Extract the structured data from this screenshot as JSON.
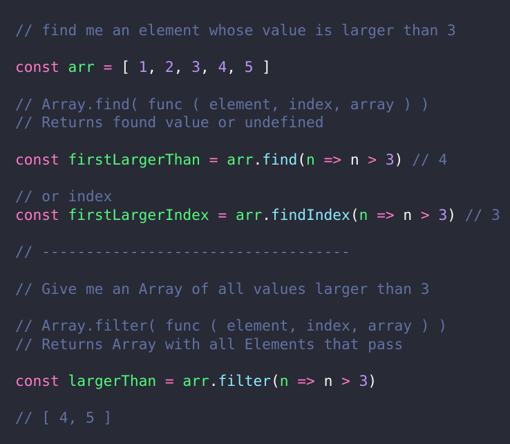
{
  "editor": {
    "theme_colors": {
      "background": "#282a36",
      "comment": "#6272a4",
      "keyword": "#ff79c6",
      "variable": "#50fa7b",
      "number": "#bd93f9",
      "method": "#8be9fd",
      "plain": "#f8f8f2"
    },
    "lines": [
      [
        {
          "t": "comment",
          "v": "// find me an element whose value is larger than 3"
        }
      ],
      [],
      [
        {
          "t": "keyword",
          "v": "const"
        },
        {
          "t": "plain",
          "v": " "
        },
        {
          "t": "variable",
          "v": "arr"
        },
        {
          "t": "plain",
          "v": " "
        },
        {
          "t": "operator",
          "v": "="
        },
        {
          "t": "plain",
          "v": " "
        },
        {
          "t": "punct",
          "v": "[ "
        },
        {
          "t": "number",
          "v": "1"
        },
        {
          "t": "punct",
          "v": ", "
        },
        {
          "t": "number",
          "v": "2"
        },
        {
          "t": "punct",
          "v": ", "
        },
        {
          "t": "number",
          "v": "3"
        },
        {
          "t": "punct",
          "v": ", "
        },
        {
          "t": "number",
          "v": "4"
        },
        {
          "t": "punct",
          "v": ", "
        },
        {
          "t": "number",
          "v": "5"
        },
        {
          "t": "punct",
          "v": " ]"
        }
      ],
      [],
      [
        {
          "t": "comment",
          "v": "// Array.find( func ( element, index, array ) )"
        }
      ],
      [
        {
          "t": "comment",
          "v": "// Returns found value or undefined"
        }
      ],
      [],
      [
        {
          "t": "keyword",
          "v": "const"
        },
        {
          "t": "plain",
          "v": " "
        },
        {
          "t": "variable",
          "v": "firstLargerThan"
        },
        {
          "t": "plain",
          "v": " "
        },
        {
          "t": "operator",
          "v": "="
        },
        {
          "t": "plain",
          "v": " "
        },
        {
          "t": "variable",
          "v": "arr"
        },
        {
          "t": "punct",
          "v": "."
        },
        {
          "t": "method",
          "v": "find"
        },
        {
          "t": "punct",
          "v": "("
        },
        {
          "t": "param",
          "v": "n"
        },
        {
          "t": "plain",
          "v": " "
        },
        {
          "t": "operator",
          "v": "=>"
        },
        {
          "t": "plain",
          "v": " n "
        },
        {
          "t": "operator",
          "v": ">"
        },
        {
          "t": "plain",
          "v": " "
        },
        {
          "t": "number",
          "v": "3"
        },
        {
          "t": "punct",
          "v": ")"
        },
        {
          "t": "plain",
          "v": " "
        },
        {
          "t": "comment",
          "v": "// 4"
        }
      ],
      [],
      [
        {
          "t": "comment",
          "v": "// or index"
        }
      ],
      [
        {
          "t": "keyword",
          "v": "const"
        },
        {
          "t": "plain",
          "v": " "
        },
        {
          "t": "variable",
          "v": "firstLargerIndex"
        },
        {
          "t": "plain",
          "v": " "
        },
        {
          "t": "operator",
          "v": "="
        },
        {
          "t": "plain",
          "v": " "
        },
        {
          "t": "variable",
          "v": "arr"
        },
        {
          "t": "punct",
          "v": "."
        },
        {
          "t": "method",
          "v": "findIndex"
        },
        {
          "t": "punct",
          "v": "("
        },
        {
          "t": "param",
          "v": "n"
        },
        {
          "t": "plain",
          "v": " "
        },
        {
          "t": "operator",
          "v": "=>"
        },
        {
          "t": "plain",
          "v": " n "
        },
        {
          "t": "operator",
          "v": ">"
        },
        {
          "t": "plain",
          "v": " "
        },
        {
          "t": "number",
          "v": "3"
        },
        {
          "t": "punct",
          "v": ")"
        },
        {
          "t": "plain",
          "v": " "
        },
        {
          "t": "comment",
          "v": "// 3"
        }
      ],
      [],
      [
        {
          "t": "comment",
          "v": "// -----------------------------------"
        }
      ],
      [],
      [
        {
          "t": "comment",
          "v": "// Give me an Array of all values larger than 3"
        }
      ],
      [],
      [
        {
          "t": "comment",
          "v": "// Array.filter( func ( element, index, array ) )"
        }
      ],
      [
        {
          "t": "comment",
          "v": "// Returns Array with all Elements that pass"
        }
      ],
      [],
      [
        {
          "t": "keyword",
          "v": "const"
        },
        {
          "t": "plain",
          "v": " "
        },
        {
          "t": "variable",
          "v": "largerThan"
        },
        {
          "t": "plain",
          "v": " "
        },
        {
          "t": "operator",
          "v": "="
        },
        {
          "t": "plain",
          "v": " "
        },
        {
          "t": "variable",
          "v": "arr"
        },
        {
          "t": "punct",
          "v": "."
        },
        {
          "t": "method",
          "v": "filter"
        },
        {
          "t": "punct",
          "v": "("
        },
        {
          "t": "param",
          "v": "n"
        },
        {
          "t": "plain",
          "v": " "
        },
        {
          "t": "operator",
          "v": "=>"
        },
        {
          "t": "plain",
          "v": " n "
        },
        {
          "t": "operator",
          "v": ">"
        },
        {
          "t": "plain",
          "v": " "
        },
        {
          "t": "number",
          "v": "3"
        },
        {
          "t": "punct",
          "v": ")"
        }
      ],
      [],
      [
        {
          "t": "comment",
          "v": "// [ 4, 5 ]"
        }
      ]
    ]
  }
}
